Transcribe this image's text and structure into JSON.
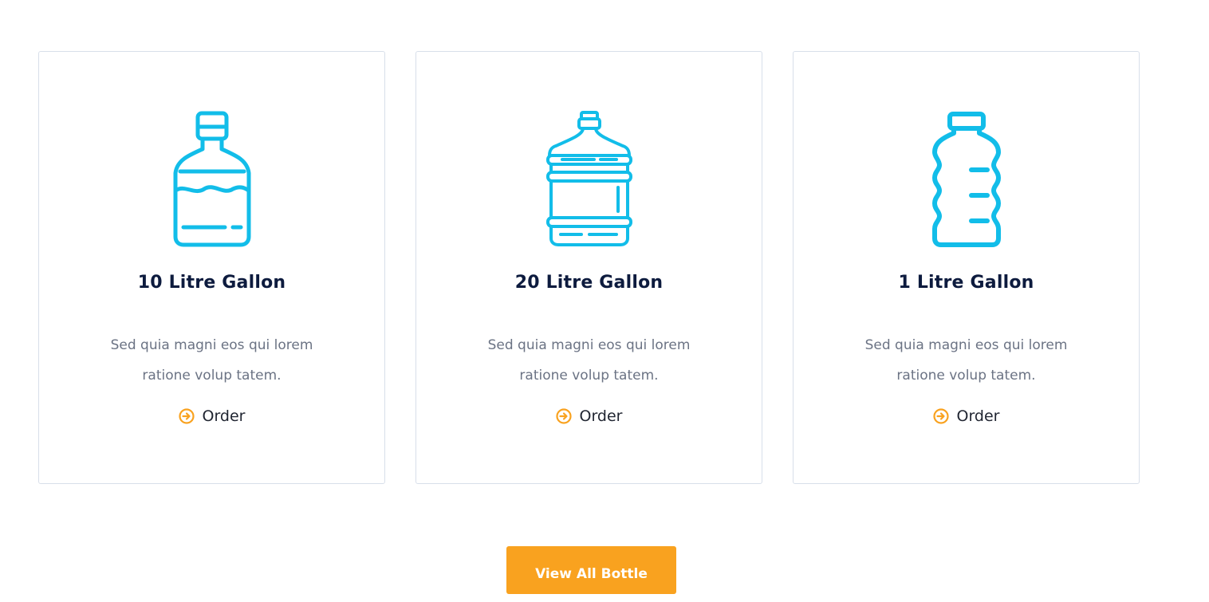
{
  "products": [
    {
      "title": "10 Litre Gallon",
      "description": "Sed quia magni eos qui lorem ratione volup tatem.",
      "order_label": "Order",
      "icon": "bottle-icon"
    },
    {
      "title": "20 Litre Gallon",
      "description": "Sed quia magni eos qui lorem ratione volup tatem.",
      "order_label": "Order",
      "icon": "water-jug-icon"
    },
    {
      "title": "1 Litre Gallon",
      "description": "Sed quia magni eos qui lorem ratione volup tatem.",
      "order_label": "Order",
      "icon": "plastic-bottle-icon"
    }
  ],
  "view_all_label": "View All Bottle",
  "colors": {
    "icon": "#12bde9",
    "accent": "#f9a21f",
    "title": "#0d1b3e",
    "text": "#6b7384",
    "border": "#d8dfea"
  }
}
